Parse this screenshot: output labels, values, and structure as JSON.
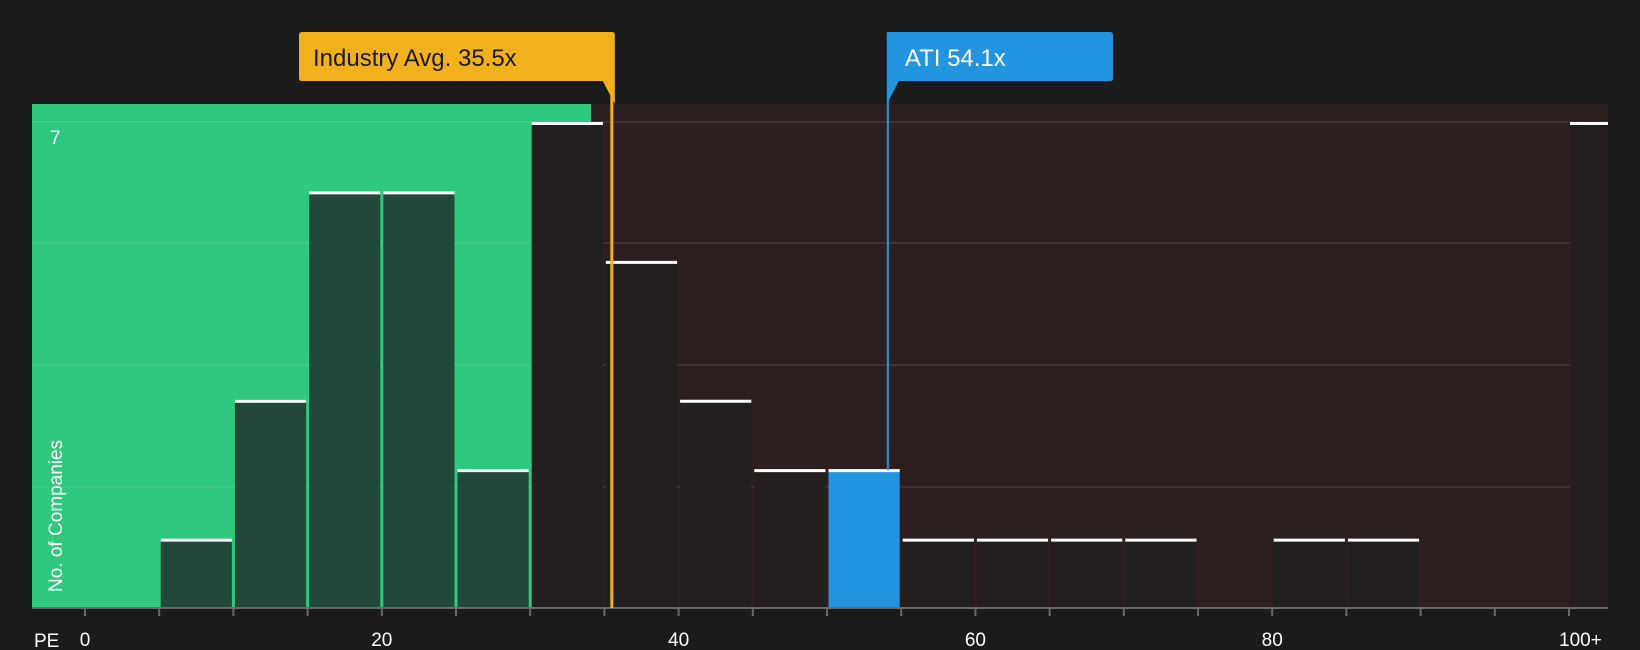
{
  "chart_data": {
    "type": "bar",
    "x_axis_label": "PE",
    "y_axis_label": "No. of Companies",
    "y_max_label": "7",
    "ylim": [
      0,
      7
    ],
    "grid": true,
    "bins": [
      {
        "x0": 0,
        "x1": 5,
        "count": 0
      },
      {
        "x0": 5,
        "x1": 10,
        "count": 1
      },
      {
        "x0": 10,
        "x1": 15,
        "count": 3
      },
      {
        "x0": 15,
        "x1": 20,
        "count": 6
      },
      {
        "x0": 20,
        "x1": 25,
        "count": 6
      },
      {
        "x0": 25,
        "x1": 30,
        "count": 2
      },
      {
        "x0": 30,
        "x1": 35,
        "count": 7
      },
      {
        "x0": 35,
        "x1": 40,
        "count": 5
      },
      {
        "x0": 40,
        "x1": 45,
        "count": 3
      },
      {
        "x0": 45,
        "x1": 50,
        "count": 2
      },
      {
        "x0": 50,
        "x1": 55,
        "count": 2,
        "highlight": true
      },
      {
        "x0": 55,
        "x1": 60,
        "count": 1
      },
      {
        "x0": 60,
        "x1": 65,
        "count": 1
      },
      {
        "x0": 65,
        "x1": 70,
        "count": 1
      },
      {
        "x0": 70,
        "x1": 75,
        "count": 1
      },
      {
        "x0": 75,
        "x1": 80,
        "count": 0
      },
      {
        "x0": 80,
        "x1": 85,
        "count": 1
      },
      {
        "x0": 85,
        "x1": 90,
        "count": 1
      },
      {
        "x0": 90,
        "x1": 95,
        "count": 0
      },
      {
        "x0": 95,
        "x1": 100,
        "count": 0
      },
      {
        "x0": 100,
        "x1": 102.5,
        "count": 7,
        "overflow": true
      }
    ],
    "x_ticks": [
      {
        "value": 0,
        "label": "0"
      },
      {
        "value": 20,
        "label": "20"
      },
      {
        "value": 40,
        "label": "40"
      },
      {
        "value": 60,
        "label": "60"
      },
      {
        "value": 80,
        "label": "80"
      },
      {
        "value": 100,
        "label": "100+"
      }
    ],
    "industry_avg": {
      "value": 35.5,
      "label": "Industry Avg. 35.5x"
    },
    "company": {
      "value": 54.1,
      "label": "ATI 54.1x"
    },
    "colors": {
      "background": "#1b1b1b",
      "undervalued_zone": "#2ec97e",
      "overvalued_zone": "#2d1f20",
      "bar_in_green": "#22483a",
      "bar_in_red": "#231f1f",
      "highlight": "#2394e0",
      "industry": "#f0b11c",
      "text": "#ffffff"
    }
  }
}
